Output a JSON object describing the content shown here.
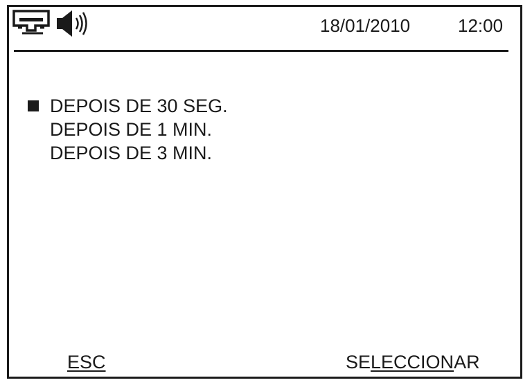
{
  "header": {
    "icons": [
      "network-icon",
      "speaker-icon"
    ],
    "date": "18/01/2010",
    "time": "12:00"
  },
  "options": [
    {
      "label": "DEPOIS DE 30 SEG.",
      "selected": true
    },
    {
      "label": "DEPOIS DE 1 MIN.",
      "selected": false
    },
    {
      "label": "DEPOIS DE 3 MIN.",
      "selected": false
    }
  ],
  "softkeys": {
    "left": "ESC",
    "right_prefix": "SE",
    "right_underlined": "LECCION",
    "right_suffix": "AR"
  },
  "colors": {
    "foreground": "#1a1a1a",
    "background": "#ffffff"
  }
}
